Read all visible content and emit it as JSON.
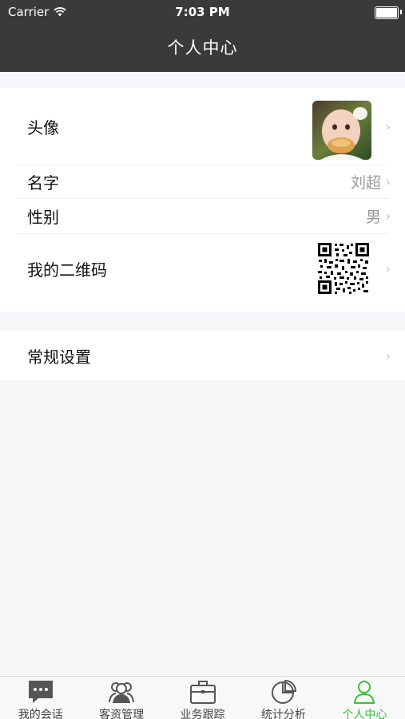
{
  "status_bar": {
    "carrier": "Carrier",
    "time": "7:03 PM"
  },
  "nav": {
    "title": "个人中心"
  },
  "profile": {
    "avatar_label": "头像",
    "name_label": "名字",
    "name_value": "刘超",
    "gender_label": "性别",
    "gender_value": "男",
    "qrcode_label": "我的二维码"
  },
  "settings": {
    "general_label": "常规设置"
  },
  "tabs": [
    {
      "label": "我的会话",
      "icon": "chat-bubble-icon"
    },
    {
      "label": "客资管理",
      "icon": "users-icon"
    },
    {
      "label": "业务跟踪",
      "icon": "briefcase-icon"
    },
    {
      "label": "统计分析",
      "icon": "pie-chart-icon"
    },
    {
      "label": "个人中心",
      "icon": "person-icon",
      "active": true
    }
  ],
  "colors": {
    "nav_bg": "#3a3a3a",
    "active_tab": "#3cbf3c",
    "secondary_text": "#9a9a9a"
  }
}
